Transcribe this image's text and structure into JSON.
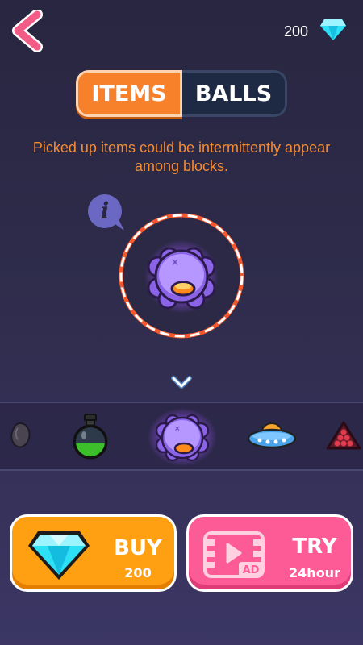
{
  "header": {
    "gem_count": "200"
  },
  "tabs": [
    {
      "label": "ITEMS",
      "active": true
    },
    {
      "label": "BALLS",
      "active": false
    }
  ],
  "description": "Picked up items could be intermittently appear among blocks.",
  "preview": {
    "item": "purple-blob-monster"
  },
  "carousel": {
    "items": [
      "egg-icon",
      "potion-icon",
      "purple-blob-icon",
      "ufo-icon",
      "triangle-balls-icon"
    ],
    "selected_index": 2
  },
  "buy": {
    "label": "BUY",
    "price": "200"
  },
  "try": {
    "label": "TRY",
    "duration": "24hour",
    "badge": "AD"
  },
  "colors": {
    "accent_orange": "#f7812b",
    "buy_orange": "#ff9f12",
    "try_pink": "#fd5b95",
    "gem_cyan": "#2ee0f5",
    "blob_purple": "#8a63e6"
  }
}
